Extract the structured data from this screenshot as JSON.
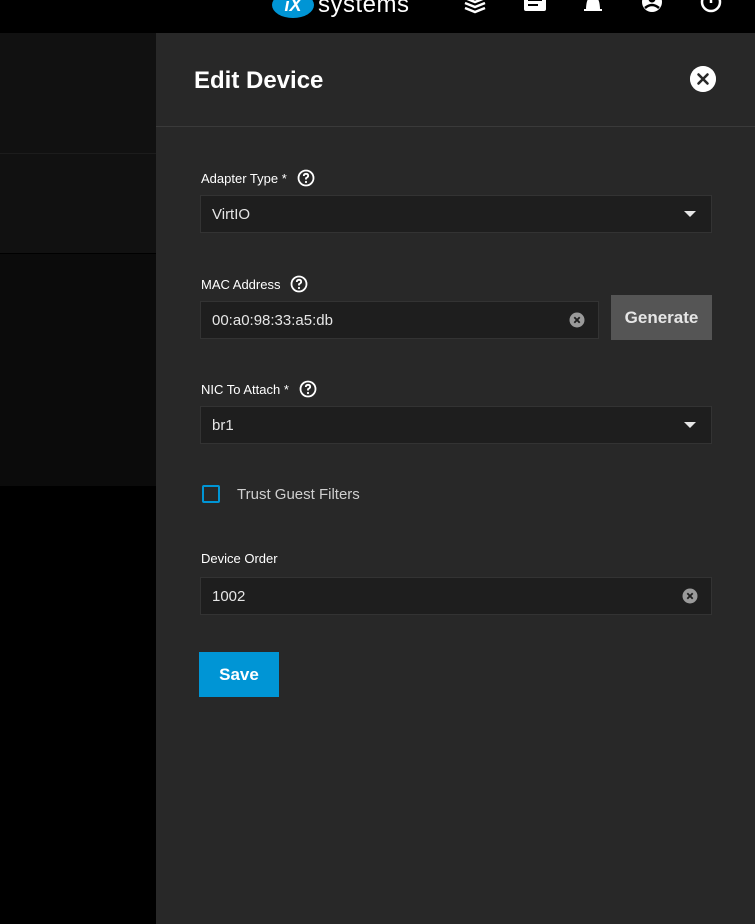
{
  "topbar": {
    "logo_badge": "iX",
    "logo_text": "systems",
    "icons": [
      "truecommand-icon",
      "tasks-icon",
      "bell-icon",
      "account-icon",
      "power-icon"
    ]
  },
  "panel": {
    "title": "Edit Device",
    "adapter_type": {
      "label": "Adapter Type *",
      "value": "VirtIO"
    },
    "mac_address": {
      "label": "MAC Address",
      "value": "00:a0:98:33:a5:db",
      "generate_label": "Generate"
    },
    "nic": {
      "label": "NIC To Attach *",
      "value": "br1"
    },
    "trust_guest_filters": {
      "label": "Trust Guest Filters",
      "checked": false
    },
    "device_order": {
      "label": "Device Order",
      "value": "1002"
    },
    "save_label": "Save"
  },
  "colors": {
    "accent": "#0095d5",
    "panel_bg": "#282828",
    "input_bg": "#1e1e1e",
    "generate_bg": "#555555"
  }
}
